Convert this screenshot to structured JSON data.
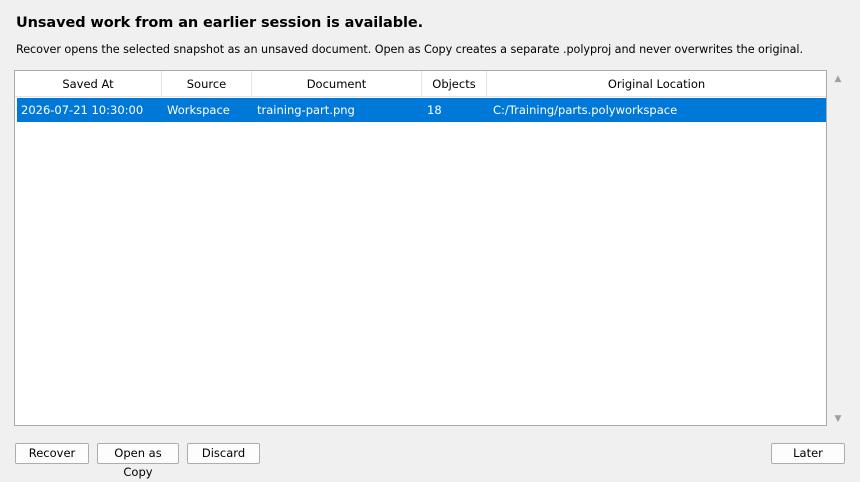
{
  "dialog": {
    "title": "Unsaved work from an earlier session is available.",
    "description": "Recover opens the selected snapshot as an unsaved document. Open as Copy creates a separate .polyproj and never overwrites the original."
  },
  "table": {
    "columns": [
      "Saved At",
      "Source",
      "Document",
      "Objects",
      "Original Location"
    ],
    "rows": [
      {
        "saved_at": "2026-07-21 10:30:00",
        "source": "Workspace",
        "document": "training-part.png",
        "objects": "18",
        "original_location": "C:/Training/parts.polyworkspace",
        "selected": true
      }
    ]
  },
  "icons": {
    "scroll_up": "▲",
    "scroll_down": "▼"
  },
  "buttons": {
    "recover": "Recover",
    "open_as_copy": "Open as Copy",
    "discard": "Discard",
    "later": "Later"
  },
  "colors": {
    "selection": "#0078d7",
    "background": "#f0f0f0"
  }
}
